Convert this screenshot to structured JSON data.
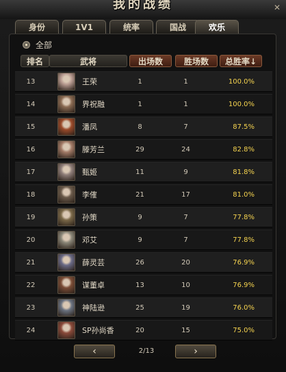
{
  "window": {
    "title": "我的战绩",
    "close_glyph": "✕"
  },
  "tabs": [
    {
      "label": "身份",
      "active": false
    },
    {
      "label": "1V1",
      "active": false
    },
    {
      "label": "统率",
      "active": false
    },
    {
      "label": "国战",
      "active": false
    },
    {
      "label": "欢乐",
      "active": true
    }
  ],
  "filter": {
    "label": "全部"
  },
  "columns": {
    "rank": "排名",
    "general": "武将",
    "games": "出场数",
    "wins": "胜场数",
    "rate": "总胜率↓"
  },
  "rows": [
    {
      "rank": "13",
      "name": "王荣",
      "games": "1",
      "wins": "1",
      "rate": "100.0%",
      "tint": "#b89b91"
    },
    {
      "rank": "14",
      "name": "界祝融",
      "games": "1",
      "wins": "1",
      "rate": "100.0%",
      "tint": "#8a6a52"
    },
    {
      "rank": "15",
      "name": "潘凤",
      "games": "8",
      "wins": "7",
      "rate": "87.5%",
      "tint": "#9a4a2a"
    },
    {
      "rank": "16",
      "name": "滕芳兰",
      "games": "29",
      "wins": "24",
      "rate": "82.8%",
      "tint": "#a27a66"
    },
    {
      "rank": "17",
      "name": "甄姬",
      "games": "11",
      "wins": "9",
      "rate": "81.8%",
      "tint": "#8f7e79"
    },
    {
      "rank": "18",
      "name": "李傕",
      "games": "21",
      "wins": "17",
      "rate": "81.0%",
      "tint": "#6a5a4a"
    },
    {
      "rank": "19",
      "name": "孙策",
      "games": "9",
      "wins": "7",
      "rate": "77.8%",
      "tint": "#7a6848"
    },
    {
      "rank": "20",
      "name": "邓艾",
      "games": "9",
      "wins": "7",
      "rate": "77.8%",
      "tint": "#8a8678"
    },
    {
      "rank": "21",
      "name": "薛灵芸",
      "games": "26",
      "wins": "20",
      "rate": "76.9%",
      "tint": "#6a6a86"
    },
    {
      "rank": "22",
      "name": "谋董卓",
      "games": "13",
      "wins": "10",
      "rate": "76.9%",
      "tint": "#7a4c36"
    },
    {
      "rank": "23",
      "name": "神陆逊",
      "games": "25",
      "wins": "19",
      "rate": "76.0%",
      "tint": "#6a7280"
    },
    {
      "rank": "24",
      "name": "SP孙尚香",
      "games": "20",
      "wins": "15",
      "rate": "75.0%",
      "tint": "#8a4a3a"
    }
  ],
  "pagination": {
    "page_text": "2/13",
    "prev_glyph": "‹",
    "next_glyph": "›"
  },
  "colors": {
    "rate_text": "#f5d34f",
    "sort_header": "#6b3a26"
  }
}
